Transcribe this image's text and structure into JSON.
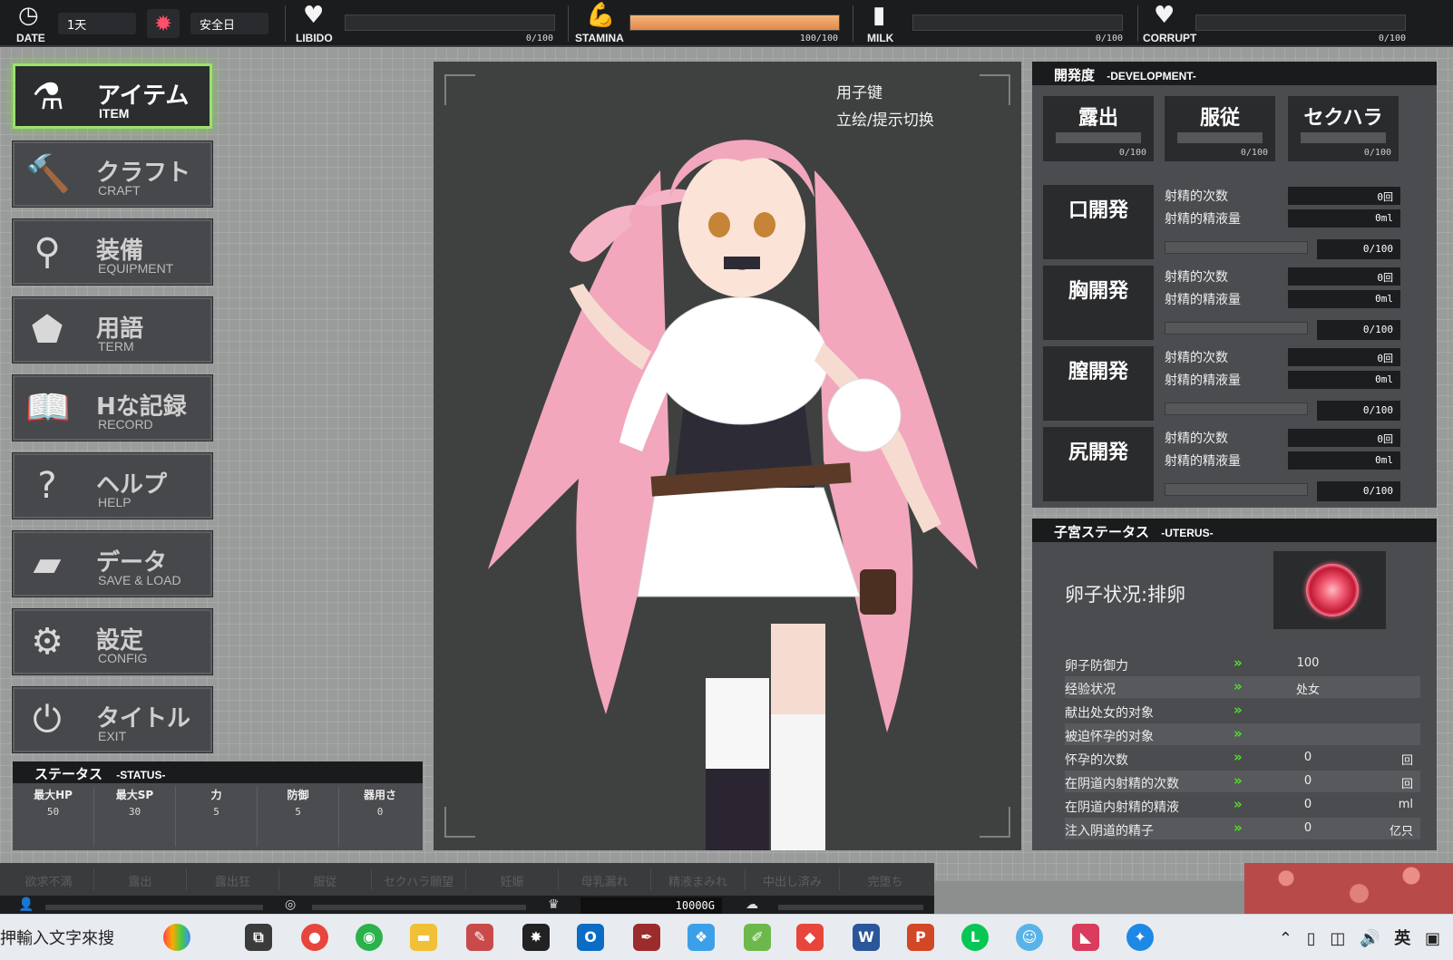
{
  "topbar": {
    "date_label": "DATE",
    "day": "1天",
    "weather_status": "安全日",
    "libido": {
      "label": "LIBIDO",
      "value": "0/100",
      "fill": 0
    },
    "stamina": {
      "label": "STAMINA",
      "value": "100/100",
      "fill": 1
    },
    "milk": {
      "label": "MILK",
      "value": "0/100",
      "fill": 0
    },
    "corrupt": {
      "label": "CORRUPT",
      "value": "0/100",
      "fill": 0
    }
  },
  "menu": [
    {
      "title": "アイテム",
      "sub": "ITEM",
      "icon": "potion-icon",
      "glyph": "⚗"
    },
    {
      "title": "クラフト",
      "sub": "CRAFT",
      "icon": "hammer-icon",
      "glyph": "🔨"
    },
    {
      "title": "装備",
      "sub": "EQUIPMENT",
      "icon": "staff-icon",
      "glyph": "⚲"
    },
    {
      "title": "用語",
      "sub": "TERM",
      "icon": "tag-icon",
      "glyph": "⬟"
    },
    {
      "title": "Hな記録",
      "sub": "RECORD",
      "icon": "book-icon",
      "glyph": "📖"
    },
    {
      "title": "ヘルプ",
      "sub": "HELP",
      "icon": "question-icon",
      "glyph": "?"
    },
    {
      "title": "データ",
      "sub": "SAVE & LOAD",
      "icon": "folder-icon",
      "glyph": "▰"
    },
    {
      "title": "設定",
      "sub": "CONFIG",
      "icon": "gear-icon",
      "glyph": "⚙"
    },
    {
      "title": "タイトル",
      "sub": "EXIT",
      "icon": "power-icon",
      "glyph": "⏻"
    }
  ],
  "status": {
    "title": "ステータス",
    "subtitle": "-STATUS-",
    "stats": [
      {
        "label": "最大HP",
        "value": "50"
      },
      {
        "label": "最大SP",
        "value": "30"
      },
      {
        "label": "力",
        "value": "5"
      },
      {
        "label": "防御",
        "value": "5"
      },
      {
        "label": "器用さ",
        "value": "0"
      }
    ]
  },
  "viewer": {
    "hint_line1": "用子键",
    "hint_line2": "立绘/提示切换"
  },
  "development": {
    "title": "開発度",
    "subtitle": "-DEVELOPMENT-",
    "top": [
      {
        "label": "露出",
        "value": "0/100"
      },
      {
        "label": "服従",
        "value": "0/100"
      },
      {
        "label": "セクハラ",
        "value": "0/100"
      }
    ],
    "rows": [
      {
        "title": "口開発",
        "count_label": "射精的次数",
        "count": "0回",
        "volume_label": "射精的精液量",
        "volume": "0ml",
        "progress": "0/100"
      },
      {
        "title": "胸開発",
        "count_label": "射精的次数",
        "count": "0回",
        "volume_label": "射精的精液量",
        "volume": "0ml",
        "progress": "0/100"
      },
      {
        "title": "膣開発",
        "count_label": "射精的次数",
        "count": "0回",
        "volume_label": "射精的精液量",
        "volume": "0ml",
        "progress": "0/100"
      },
      {
        "title": "尻開発",
        "count_label": "射精的次数",
        "count": "0回",
        "volume_label": "射精的精液量",
        "volume": "0ml",
        "progress": "0/100"
      }
    ]
  },
  "uterus": {
    "title": "子宮ステータス",
    "subtitle": "-UTERUS-",
    "ovum_status": "卵子状况:排卵",
    "arrow": "»",
    "rows": [
      {
        "label": "卵子防御力",
        "value": "100",
        "unit": ""
      },
      {
        "label": "经验状况",
        "value": "处女",
        "unit": ""
      },
      {
        "label": "献出处女的对象",
        "value": "",
        "unit": ""
      },
      {
        "label": "被迫怀孕的对象",
        "value": "",
        "unit": ""
      },
      {
        "label": "怀孕的次数",
        "value": "0",
        "unit": "回"
      },
      {
        "label": "在阴道内射精的次数",
        "value": "0",
        "unit": "回"
      },
      {
        "label": "在阴道内射精的精液",
        "value": "0",
        "unit": "ml"
      },
      {
        "label": "注入阴道的精子",
        "value": "0",
        "unit": "亿只"
      }
    ]
  },
  "flags": [
    "欲求不満",
    "露出",
    "露出狂",
    "服従",
    "セクハラ願望",
    "妊娠",
    "母乳漏れ",
    "精液まみれ",
    "中出し済み",
    "完堕ち"
  ],
  "money": "10000G",
  "taskbar": {
    "ime_text": "押輸入文字來搜",
    "tray_lang": "英"
  }
}
